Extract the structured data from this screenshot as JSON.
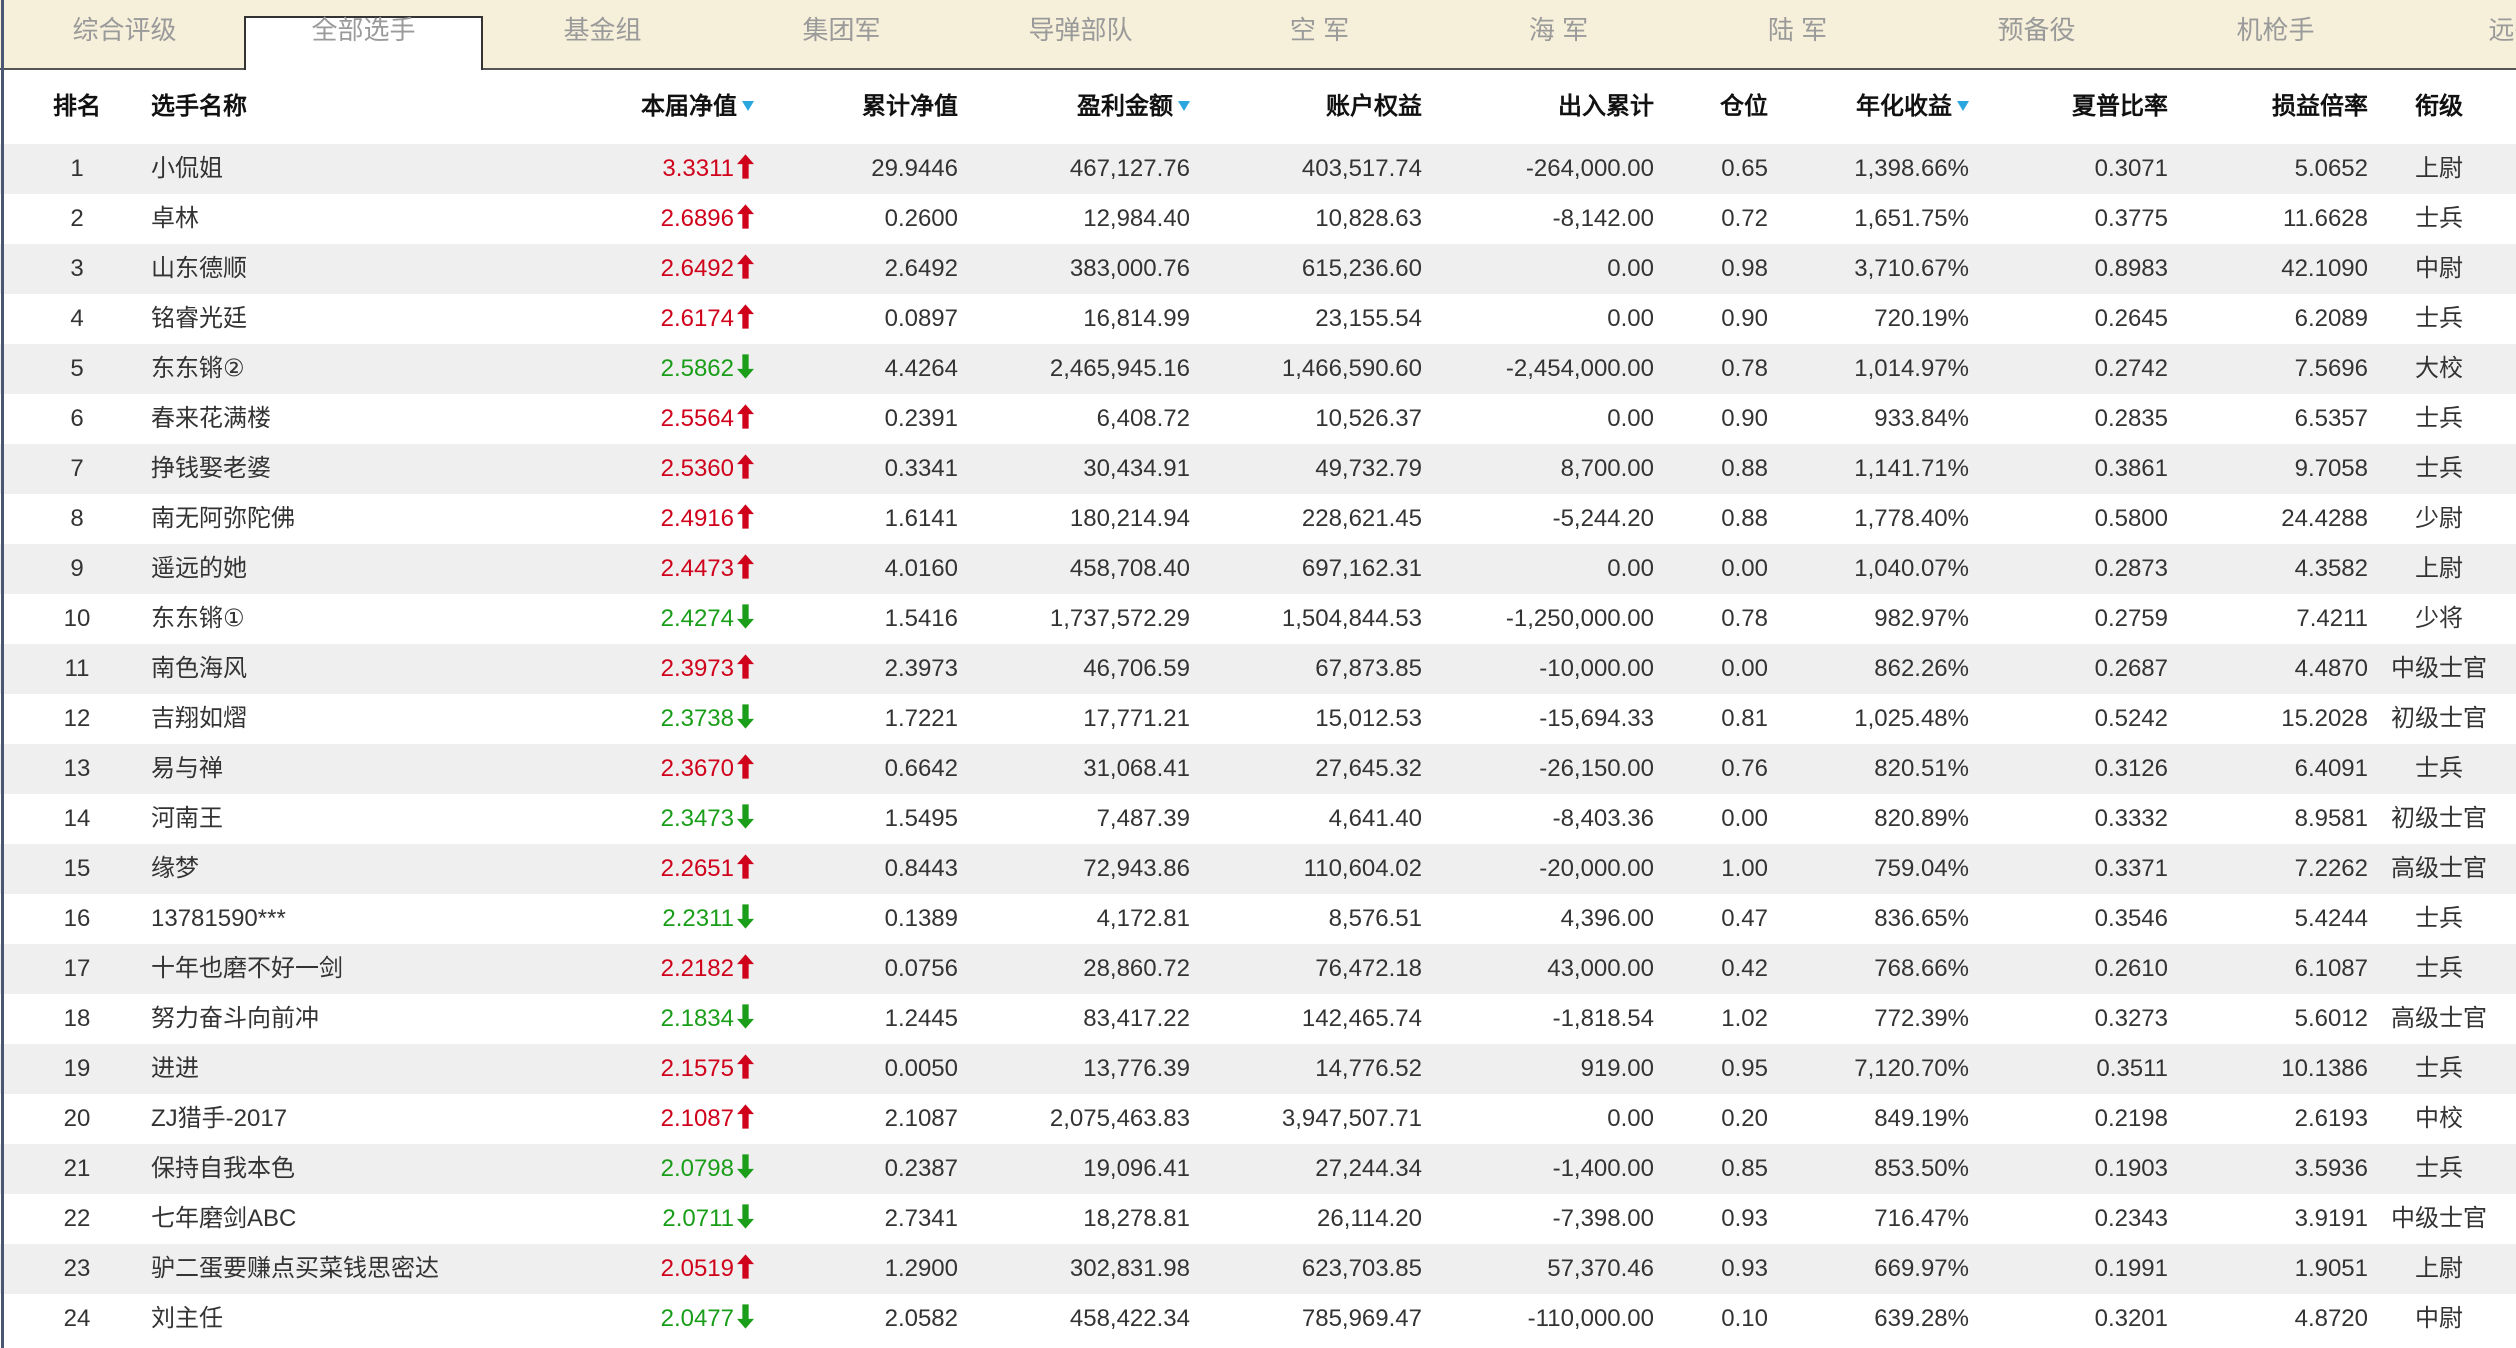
{
  "tabs": [
    {
      "label": "综合评级",
      "active": false
    },
    {
      "label": "全部选手",
      "active": true
    },
    {
      "label": "基金组",
      "active": false
    },
    {
      "label": "集团军",
      "active": false
    },
    {
      "label": "导弹部队",
      "active": false
    },
    {
      "label": "空 军",
      "active": false
    },
    {
      "label": "海 军",
      "active": false
    },
    {
      "label": "陆 军",
      "active": false
    },
    {
      "label": "预备役",
      "active": false
    },
    {
      "label": "机枪手",
      "active": false
    },
    {
      "label": "远征",
      "active": false
    }
  ],
  "table": {
    "headers": {
      "rank": "排名",
      "name": "选手名称",
      "net_value": "本届净值",
      "cum_net_value": "累计净值",
      "profit": "盈利金额",
      "equity": "账户权益",
      "flow": "出入累计",
      "position": "仓位",
      "annual": "年化收益",
      "sharpe": "夏普比率",
      "pl_ratio": "损益倍率",
      "title": "衔级"
    },
    "sort_icon": "sort-desc-icon"
  },
  "rows": [
    {
      "rank": "1",
      "name": "小侃姐",
      "net_value": "3.3311",
      "trend": "up",
      "cum_net_value": "29.9446",
      "profit": "467,127.76",
      "equity": "403,517.74",
      "flow": "-264,000.00",
      "position": "0.65",
      "annual": "1,398.66%",
      "sharpe": "0.3071",
      "pl_ratio": "5.0652",
      "title": "上尉"
    },
    {
      "rank": "2",
      "name": "卓林",
      "net_value": "2.6896",
      "trend": "up",
      "cum_net_value": "0.2600",
      "profit": "12,984.40",
      "equity": "10,828.63",
      "flow": "-8,142.00",
      "position": "0.72",
      "annual": "1,651.75%",
      "sharpe": "0.3775",
      "pl_ratio": "11.6628",
      "title": "士兵"
    },
    {
      "rank": "3",
      "name": "山东德顺",
      "net_value": "2.6492",
      "trend": "up",
      "cum_net_value": "2.6492",
      "profit": "383,000.76",
      "equity": "615,236.60",
      "flow": "0.00",
      "position": "0.98",
      "annual": "3,710.67%",
      "sharpe": "0.8983",
      "pl_ratio": "42.1090",
      "title": "中尉"
    },
    {
      "rank": "4",
      "name": "铭睿光廷",
      "net_value": "2.6174",
      "trend": "up",
      "cum_net_value": "0.0897",
      "profit": "16,814.99",
      "equity": "23,155.54",
      "flow": "0.00",
      "position": "0.90",
      "annual": "720.19%",
      "sharpe": "0.2645",
      "pl_ratio": "6.2089",
      "title": "士兵"
    },
    {
      "rank": "5",
      "name": "东东锵②",
      "net_value": "2.5862",
      "trend": "down",
      "cum_net_value": "4.4264",
      "profit": "2,465,945.16",
      "equity": "1,466,590.60",
      "flow": "-2,454,000.00",
      "position": "0.78",
      "annual": "1,014.97%",
      "sharpe": "0.2742",
      "pl_ratio": "7.5696",
      "title": "大校"
    },
    {
      "rank": "6",
      "name": "春来花满楼",
      "net_value": "2.5564",
      "trend": "up",
      "cum_net_value": "0.2391",
      "profit": "6,408.72",
      "equity": "10,526.37",
      "flow": "0.00",
      "position": "0.90",
      "annual": "933.84%",
      "sharpe": "0.2835",
      "pl_ratio": "6.5357",
      "title": "士兵"
    },
    {
      "rank": "7",
      "name": "挣钱娶老婆",
      "net_value": "2.5360",
      "trend": "up",
      "cum_net_value": "0.3341",
      "profit": "30,434.91",
      "equity": "49,732.79",
      "flow": "8,700.00",
      "position": "0.88",
      "annual": "1,141.71%",
      "sharpe": "0.3861",
      "pl_ratio": "9.7058",
      "title": "士兵"
    },
    {
      "rank": "8",
      "name": "南无阿弥陀佛",
      "net_value": "2.4916",
      "trend": "up",
      "cum_net_value": "1.6141",
      "profit": "180,214.94",
      "equity": "228,621.45",
      "flow": "-5,244.20",
      "position": "0.88",
      "annual": "1,778.40%",
      "sharpe": "0.5800",
      "pl_ratio": "24.4288",
      "title": "少尉"
    },
    {
      "rank": "9",
      "name": "遥远的她",
      "net_value": "2.4473",
      "trend": "up",
      "cum_net_value": "4.0160",
      "profit": "458,708.40",
      "equity": "697,162.31",
      "flow": "0.00",
      "position": "0.00",
      "annual": "1,040.07%",
      "sharpe": "0.2873",
      "pl_ratio": "4.3582",
      "title": "上尉"
    },
    {
      "rank": "10",
      "name": "东东锵①",
      "net_value": "2.4274",
      "trend": "down",
      "cum_net_value": "1.5416",
      "profit": "1,737,572.29",
      "equity": "1,504,844.53",
      "flow": "-1,250,000.00",
      "position": "0.78",
      "annual": "982.97%",
      "sharpe": "0.2759",
      "pl_ratio": "7.4211",
      "title": "少将"
    },
    {
      "rank": "11",
      "name": "南色海风",
      "net_value": "2.3973",
      "trend": "up",
      "cum_net_value": "2.3973",
      "profit": "46,706.59",
      "equity": "67,873.85",
      "flow": "-10,000.00",
      "position": "0.00",
      "annual": "862.26%",
      "sharpe": "0.2687",
      "pl_ratio": "4.4870",
      "title": "中级士官"
    },
    {
      "rank": "12",
      "name": "吉翔如熠",
      "net_value": "2.3738",
      "trend": "down",
      "cum_net_value": "1.7221",
      "profit": "17,771.21",
      "equity": "15,012.53",
      "flow": "-15,694.33",
      "position": "0.81",
      "annual": "1,025.48%",
      "sharpe": "0.5242",
      "pl_ratio": "15.2028",
      "title": "初级士官"
    },
    {
      "rank": "13",
      "name": "易与禅",
      "net_value": "2.3670",
      "trend": "up",
      "cum_net_value": "0.6642",
      "profit": "31,068.41",
      "equity": "27,645.32",
      "flow": "-26,150.00",
      "position": "0.76",
      "annual": "820.51%",
      "sharpe": "0.3126",
      "pl_ratio": "6.4091",
      "title": "士兵"
    },
    {
      "rank": "14",
      "name": "河南王",
      "net_value": "2.3473",
      "trend": "down",
      "cum_net_value": "1.5495",
      "profit": "7,487.39",
      "equity": "4,641.40",
      "flow": "-8,403.36",
      "position": "0.00",
      "annual": "820.89%",
      "sharpe": "0.3332",
      "pl_ratio": "8.9581",
      "title": "初级士官"
    },
    {
      "rank": "15",
      "name": "缘梦",
      "net_value": "2.2651",
      "trend": "up",
      "cum_net_value": "0.8443",
      "profit": "72,943.86",
      "equity": "110,604.02",
      "flow": "-20,000.00",
      "position": "1.00",
      "annual": "759.04%",
      "sharpe": "0.3371",
      "pl_ratio": "7.2262",
      "title": "高级士官"
    },
    {
      "rank": "16",
      "name": "13781590***",
      "net_value": "2.2311",
      "trend": "down",
      "cum_net_value": "0.1389",
      "profit": "4,172.81",
      "equity": "8,576.51",
      "flow": "4,396.00",
      "position": "0.47",
      "annual": "836.65%",
      "sharpe": "0.3546",
      "pl_ratio": "5.4244",
      "title": "士兵"
    },
    {
      "rank": "17",
      "name": "十年也磨不好一剑",
      "net_value": "2.2182",
      "trend": "up",
      "cum_net_value": "0.0756",
      "profit": "28,860.72",
      "equity": "76,472.18",
      "flow": "43,000.00",
      "position": "0.42",
      "annual": "768.66%",
      "sharpe": "0.2610",
      "pl_ratio": "6.1087",
      "title": "士兵"
    },
    {
      "rank": "18",
      "name": "努力奋斗向前冲",
      "net_value": "2.1834",
      "trend": "down",
      "cum_net_value": "1.2445",
      "profit": "83,417.22",
      "equity": "142,465.74",
      "flow": "-1,818.54",
      "position": "1.02",
      "annual": "772.39%",
      "sharpe": "0.3273",
      "pl_ratio": "5.6012",
      "title": "高级士官"
    },
    {
      "rank": "19",
      "name": "进进",
      "net_value": "2.1575",
      "trend": "up",
      "cum_net_value": "0.0050",
      "profit": "13,776.39",
      "equity": "14,776.52",
      "flow": "919.00",
      "position": "0.95",
      "annual": "7,120.70%",
      "sharpe": "0.3511",
      "pl_ratio": "10.1386",
      "title": "士兵"
    },
    {
      "rank": "20",
      "name": "ZJ猎手-2017",
      "net_value": "2.1087",
      "trend": "up",
      "cum_net_value": "2.1087",
      "profit": "2,075,463.83",
      "equity": "3,947,507.71",
      "flow": "0.00",
      "position": "0.20",
      "annual": "849.19%",
      "sharpe": "0.2198",
      "pl_ratio": "2.6193",
      "title": "中校"
    },
    {
      "rank": "21",
      "name": "保持自我本色",
      "net_value": "2.0798",
      "trend": "down",
      "cum_net_value": "0.2387",
      "profit": "19,096.41",
      "equity": "27,244.34",
      "flow": "-1,400.00",
      "position": "0.85",
      "annual": "853.50%",
      "sharpe": "0.1903",
      "pl_ratio": "3.5936",
      "title": "士兵"
    },
    {
      "rank": "22",
      "name": "七年磨剑ABC",
      "net_value": "2.0711",
      "trend": "down",
      "cum_net_value": "2.7341",
      "profit": "18,278.81",
      "equity": "26,114.20",
      "flow": "-7,398.00",
      "position": "0.93",
      "annual": "716.47%",
      "sharpe": "0.2343",
      "pl_ratio": "3.9191",
      "title": "中级士官"
    },
    {
      "rank": "23",
      "name": "驴二蛋要赚点买菜钱思密达",
      "net_value": "2.0519",
      "trend": "up",
      "cum_net_value": "1.2900",
      "profit": "302,831.98",
      "equity": "623,703.85",
      "flow": "57,370.46",
      "position": "0.93",
      "annual": "669.97%",
      "sharpe": "0.1991",
      "pl_ratio": "1.9051",
      "title": "上尉"
    },
    {
      "rank": "24",
      "name": "刘主任",
      "net_value": "2.0477",
      "trend": "down",
      "cum_net_value": "2.0582",
      "profit": "458,422.34",
      "equity": "785,969.47",
      "flow": "-110,000.00",
      "position": "0.10",
      "annual": "639.28%",
      "sharpe": "0.3201",
      "pl_ratio": "4.8720",
      "title": "中尉"
    }
  ],
  "icons": {
    "up": "arrow-up-icon",
    "down": "arrow-down-icon"
  },
  "colors": {
    "up": "#d0021b",
    "down": "#1a9e1a",
    "sort_icon": "#2ba6de",
    "tab_background": "#f6f0da",
    "stripe": "#efefef"
  }
}
